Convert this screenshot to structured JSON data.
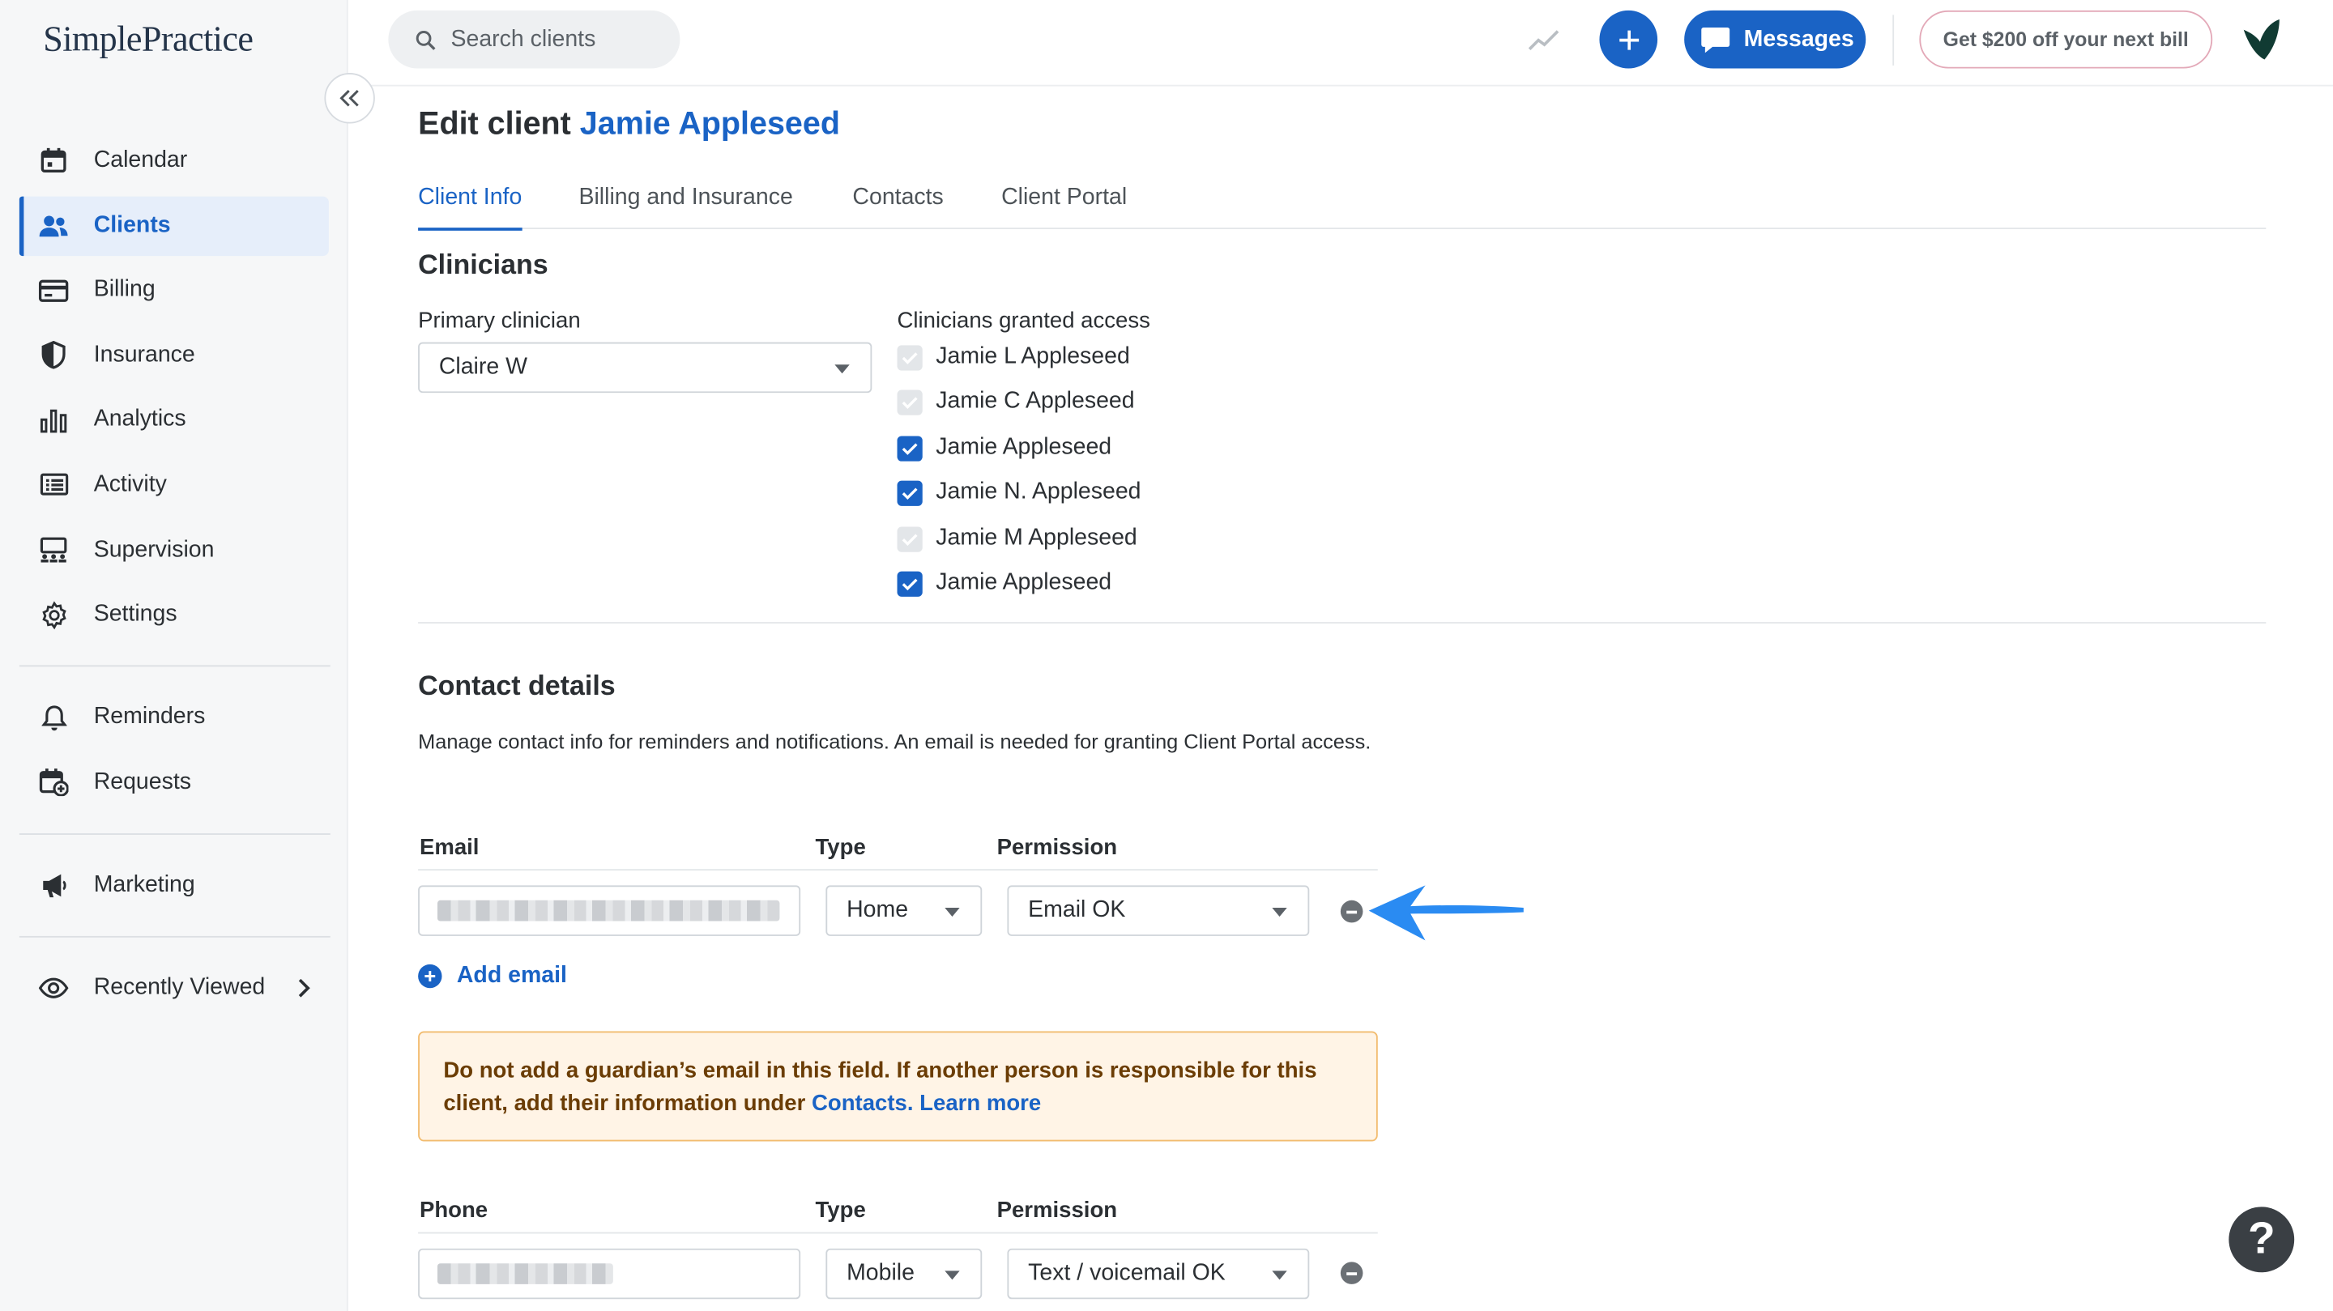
{
  "app": {
    "logo_text": "SimplePractice"
  },
  "sidebar": {
    "items": [
      {
        "label": "Calendar",
        "icon": "calendar-icon"
      },
      {
        "label": "Clients",
        "icon": "users-icon",
        "active": true
      },
      {
        "label": "Billing",
        "icon": "credit-card-icon"
      },
      {
        "label": "Insurance",
        "icon": "shield-icon"
      },
      {
        "label": "Analytics",
        "icon": "bar-chart-icon"
      },
      {
        "label": "Activity",
        "icon": "list-icon"
      },
      {
        "label": "Supervision",
        "icon": "supervision-icon"
      },
      {
        "label": "Settings",
        "icon": "gear-icon"
      }
    ],
    "secondary": [
      {
        "label": "Reminders",
        "icon": "bell-icon"
      },
      {
        "label": "Requests",
        "icon": "calendar-plus-icon"
      }
    ],
    "marketing": {
      "label": "Marketing",
      "icon": "megaphone-icon"
    },
    "recent": {
      "label": "Recently Viewed",
      "icon": "eye-icon"
    }
  },
  "topbar": {
    "search_placeholder": "Search clients",
    "messages_label": "Messages",
    "promo_label": "Get $200 off your next bill"
  },
  "page": {
    "title_prefix": "Edit client",
    "client_name": "Jamie Appleseed",
    "tabs": [
      "Client Info",
      "Billing and Insurance",
      "Contacts",
      "Client Portal"
    ],
    "active_tab": "Client Info"
  },
  "clinicians": {
    "section_title": "Clinicians",
    "primary_label": "Primary clinician",
    "primary_value": "Claire W",
    "granted_label": "Clinicians granted access",
    "granted": [
      {
        "name": "Jamie L Appleseed",
        "checked": false
      },
      {
        "name": "Jamie C Appleseed",
        "checked": false
      },
      {
        "name": "Jamie Appleseed",
        "checked": true
      },
      {
        "name": "Jamie N. Appleseed",
        "checked": true
      },
      {
        "name": "Jamie M Appleseed",
        "checked": false
      },
      {
        "name": "Jamie Appleseed",
        "checked": true
      }
    ]
  },
  "contact": {
    "section_title": "Contact details",
    "description": "Manage contact info for reminders and notifications. An email is needed for granting Client Portal access.",
    "email_head": "Email",
    "type_head": "Type",
    "permission_head": "Permission",
    "email_type": "Home",
    "email_permission": "Email OK",
    "add_email_label": "Add email",
    "warning_text": "Do not add a guardian’s email in this field. If another person is responsible for this client, add their information under",
    "warning_link_contacts": "Contacts.",
    "warning_link_learn": "Learn more",
    "phone_head": "Phone",
    "phone_type": "Mobile",
    "phone_permission": "Text / voicemail OK"
  },
  "help": {
    "label": "?"
  },
  "colors": {
    "accent": "#1a63c5",
    "warning_bg": "#fff4e6",
    "warning_border": "#f2bc6f",
    "annotation_arrow": "#2a8bf2"
  }
}
